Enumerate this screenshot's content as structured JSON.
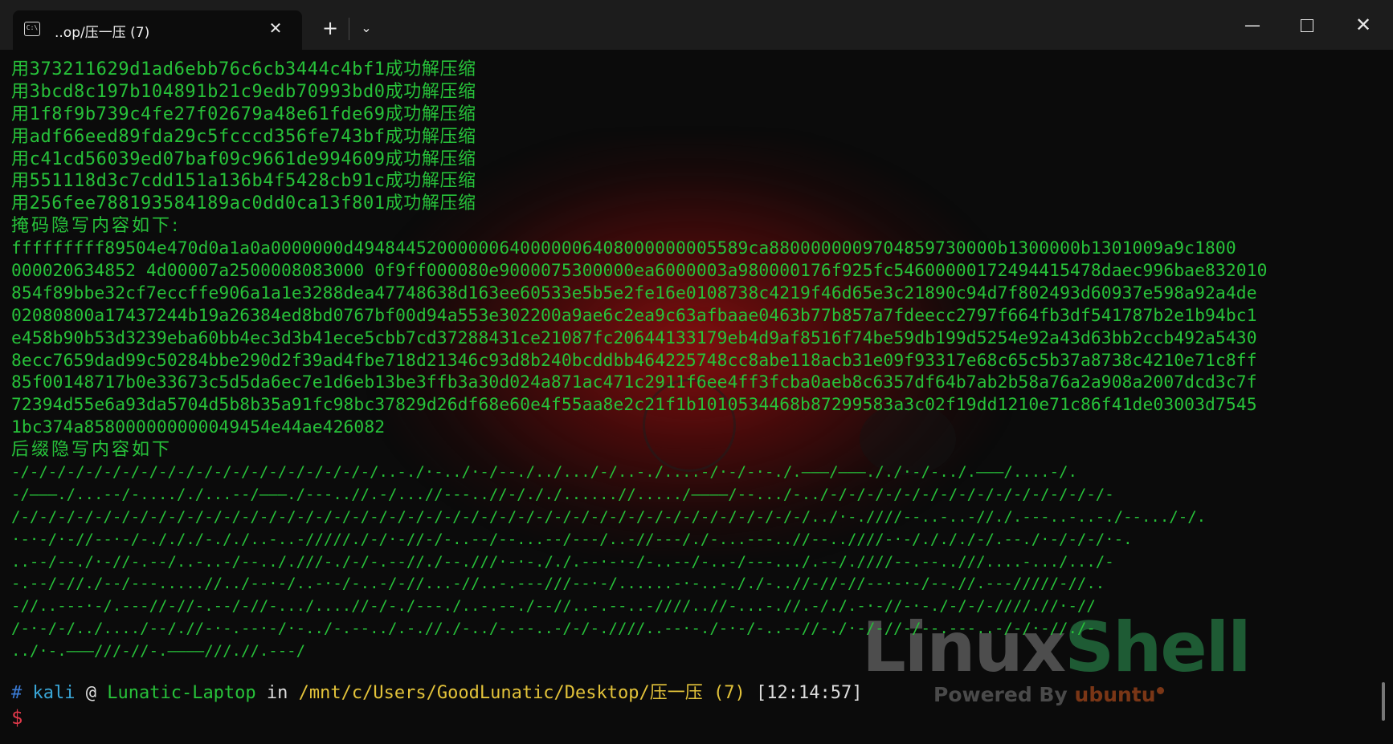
{
  "window": {
    "tab_title": "..op/压一压 (7)",
    "tab_icon": "terminal-icon",
    "new_tab_glyph": "+",
    "dropdown_glyph": "⌄",
    "minimize_glyph": "—",
    "close_glyph": "✕"
  },
  "terminal": {
    "password_lines": [
      "用373211629d1ad6ebb76c6cb3444c4bf1成功解压缩",
      "用3bcd8c197b104891b21c9edb70993bd0成功解压缩",
      "用1f8f9b739c4fe27f02679a48e61fde69成功解压缩",
      "用adf66eed89fda29c5fcccd356fe743bf成功解压缩",
      "用c41cd56039ed07baf09c9661de994609成功解压缩",
      "用551118d3c7cdd151a136b4f5428cb91c成功解压缩",
      "用256fee788193584189ac0dd0ca13f801成功解压缩"
    ],
    "mask_label": "掩码隐写内容如下:",
    "mask_hex_lines": [
      "fffffffff89504e470d0a1a0a0000000d49484452000000640000006408000000005589ca8800000009704859730000b1300000b1301009a9c1800",
      "000020634852 4d00007a2500008083000 0f9ff000080e9000075300000ea6000003a980000176f925fc54600000172494415478daec996bae832010",
      "854f89bbe32cf7eccffe906a1a1e3288dea47748638d163ee60533e5b5e2fe16e0108738c4219f46d65e3c21890c94d7f802493d60937e598a92a4de",
      "02080800a17437244b19a26384ed8bd0767bf00d94a553e302200a9ae6c2ea9c63afbaae0463b77b857a7fdeecc2797f664fb3df541787b2e1b94bc1",
      "e458b90b53d3239eba60bb4ec3d3b41ece5cbb7cd37288431ce21087fc20644133179eb4d9af8516f74be59db199d5254e92a43d63bb2ccb492a5430",
      "8ecc7659dad99c50284bbe290d2f39ad4fbe718d21346c93d8b240bcddbb464225748cc8abe118acb31e09f93317e68c65c5b37a8738c4210e71c8ff",
      "85f00148717b0e33673c5d5da6ec7e1d6eb13be3ffb3a30d024a871ac471c2911f6ee4ff3fcba0aeb8c6357df64b7ab2b58a76a2a908a2007dcd3c7f",
      "72394d55e6a93da5704d5b8b35a91fc98bc37829d26df68e60e4f55aa8e2c21f1b1010534468b87299583a3c02f19dd1210e71c86f41de03003d7545",
      "1bc374a858000000000049454e44ae426082"
    ],
    "suffix_label": "后缀隐写内容如下",
    "morse_lines": [
      "-/-/-/-/-/-/-/-/-/-/-/-/-/-/-/-/-/-/-/-/..-./·-../·-/--./../.../-/..-./....-/·-/-·-./.———/———././·-/-../.———/....-/.",
      "-/———./...--/-...././...--/———./---..//.-/...//---..//-/././......//...../————/--.../-../-/-/-/-/-/-/-/-/-/-/-/-/-/-/-/-",
      "/-/-/-/-/-/-/-/-/-/-/-/-/-/-/-/-/-/-/-/-/-/-/-/-/-/-/-/-/-/-/-/-/-/-/-/-/-/-/-/-/-/-/-/../·-.////--..-..-//./.---..-..-./--.../-/.",
      "·-·-/·-//--·-/-./././-././..-..-/////./-/·-//-/-..--/--...--/---/..-//---/./-...---..//--..////-·-/./././-/.--./·-/-/-/·-.",
      "..--/--./·-//-.--/..-..-/--.././//-./-/-.--//./--.///·-·-././.--·-·-/-..--/-..-/---.../.--/.////--.--..///....-.../.../-",
      "-.--/-//./--/---.....//../--·-/..-·-/-..-/-//...-//..-.---///--·-/......-·-..-././-..//-//-//--·-·-/--.//.---/////-//..",
      "-//..---·-/.---//-//-.--/-//-.../....//-/-./---./..-.--./--//..-.--..-////..//-...-.//.-/./.-·-//-·-./-/-/-////.//·-//",
      "/-·-/-/../..../--/.//-·-.--·-/·-../-.--../.-.//./-../-.--..-/-/-.////..--·-./-·-/-..--//-./·-/-//-/--.---..-/-/·-//./-",
      "../·-.———///-//-.————///.//.---/"
    ],
    "prompt": {
      "hash": "#",
      "user": "kali",
      "at": "@",
      "host": "Lunatic-Laptop",
      "in": "in",
      "path": "/mnt/c/Users/GoodLunatic/Desktop/压一压 (7)",
      "time": "[12:14:57]",
      "symbol": "$"
    }
  },
  "wallpaper": {
    "logo_part1": "Linux",
    "logo_part2": "Shell",
    "powered_by": "Powered By",
    "brand": "ubuntu"
  },
  "colors": {
    "terminal_green": "#27c23a",
    "prompt_path_yellow": "#e3c33a",
    "prompt_red": "#e0394a",
    "prompt_blue": "#3aa7d8"
  }
}
